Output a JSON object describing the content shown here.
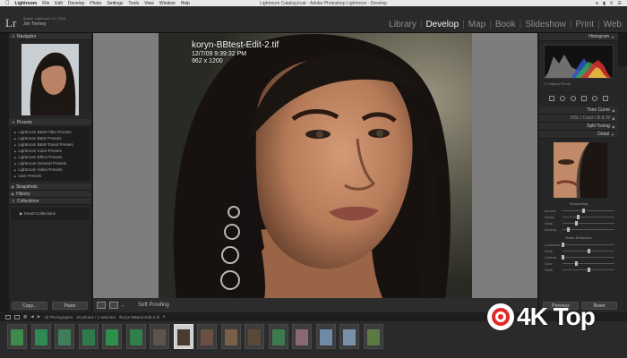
{
  "menubar": {
    "app_name": "Lightroom",
    "items": [
      "File",
      "Edit",
      "Develop",
      "Photo",
      "Settings",
      "Tools",
      "View",
      "Window",
      "Help"
    ],
    "window_title": "Lightroom Catalog.lrcat - Adobe Photoshop Lightroom - Develop"
  },
  "identity": {
    "logo": "Lr",
    "catalog_line": "Adobe Lightroom CC 2015",
    "user": "Jim Tierney"
  },
  "modules": {
    "library": "Library",
    "develop": "Develop",
    "map": "Map",
    "book": "Book",
    "slideshow": "Slideshow",
    "print": "Print",
    "web": "Web",
    "active": "Develop"
  },
  "left_panel": {
    "navigator": {
      "title": "Navigator",
      "zoom_options": [
        "FIT",
        "FILL",
        "1:1",
        "3:1"
      ]
    },
    "presets": {
      "title": "Presets",
      "items": [
        "Lightroom B&W Filter Presets",
        "Lightroom B&W Presets",
        "Lightroom B&W Toned Presets",
        "Lightroom Color Presets",
        "Lightroom Effect Presets",
        "Lightroom General Presets",
        "Lightroom Video Presets",
        "User Presets"
      ]
    },
    "snapshots": {
      "title": "Snapshots"
    },
    "history": {
      "title": "History"
    },
    "collections": {
      "title": "Collections",
      "smart_collections": "Smart Collections"
    },
    "copy_button": "Copy...",
    "paste_button": "Paste"
  },
  "image_info": {
    "filename": "koryn-BBtest-Edit-2.tif",
    "datetime": "12/7/09 9:39:32 PM",
    "dimensions": "962 x 1200"
  },
  "toolbar": {
    "soft_proofing": "Soft Proofing"
  },
  "right_panel": {
    "histogram": {
      "title": "Histogram"
    },
    "original_photo": "Original Photo",
    "panels": [
      {
        "label": "Tone Curve"
      },
      {
        "label": "HSL / Color / B & W"
      },
      {
        "label": "Split Toning"
      },
      {
        "label": "Detail"
      }
    ],
    "sharpening": {
      "title": "Sharpening",
      "sliders": [
        {
          "label": "Amount",
          "value": 0.4
        },
        {
          "label": "Radius",
          "value": 0.3
        },
        {
          "label": "Detail",
          "value": 0.25
        },
        {
          "label": "Masking",
          "value": 0.1
        }
      ]
    },
    "noise_reduction": {
      "title": "Noise Reduction",
      "sliders": [
        {
          "label": "Luminance",
          "value": 0.0
        },
        {
          "label": "Detail",
          "value": 0.5
        },
        {
          "label": "Contrast",
          "value": 0.0
        },
        {
          "label": "Color",
          "value": 0.25
        },
        {
          "label": "Detail",
          "value": 0.5
        }
      ]
    },
    "previous_button": "Previous",
    "reset_button": "Reset"
  },
  "filmstrip_bar": {
    "pages": [
      "1",
      "2"
    ],
    "source": "All Photographs",
    "summary": "10 photos / 1 selected",
    "selected_file": "/koryn-BBtest-Edit-2.tif"
  },
  "filmstrip": {
    "thumbs": [
      {
        "color": "#3d8a4a",
        "selected": false
      },
      {
        "color": "#2f8a55",
        "selected": false
      },
      {
        "color": "#3e7e58",
        "selected": false
      },
      {
        "color": "#2f7a4c",
        "selected": false
      },
      {
        "color": "#2e8f4d",
        "selected": false
      },
      {
        "color": "#31804a",
        "selected": false
      },
      {
        "color": "#5e5548",
        "selected": false
      },
      {
        "color": "#4a3b30",
        "selected": true
      },
      {
        "color": "#6a5040",
        "selected": false
      },
      {
        "color": "#7a6048",
        "selected": false
      },
      {
        "color": "#5a4838",
        "selected": false
      },
      {
        "color": "#3d7a50",
        "selected": false
      },
      {
        "color": "#8a6a70",
        "selected": false
      },
      {
        "color": "#6f8aa6",
        "selected": false
      },
      {
        "color": "#7a8fa8",
        "selected": false
      },
      {
        "color": "#5e7a44",
        "selected": false
      }
    ]
  },
  "watermark": {
    "text": "4K Top"
  }
}
